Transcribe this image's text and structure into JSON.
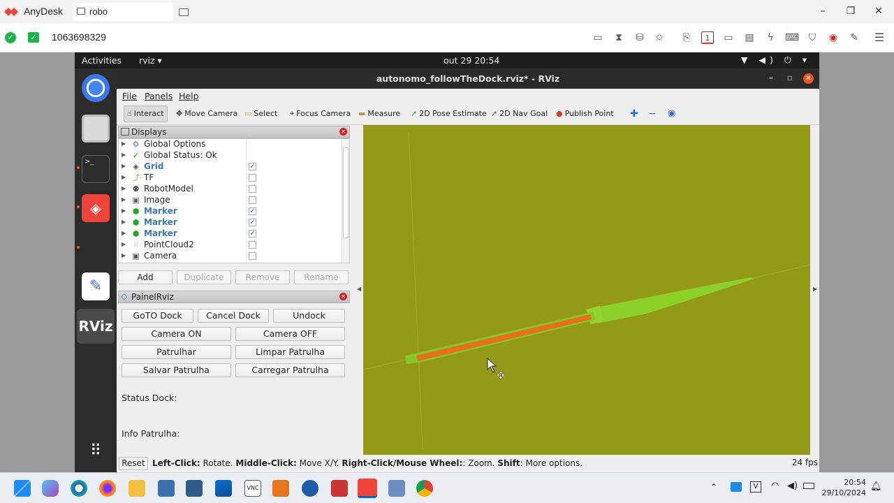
{
  "anydesk": {
    "app_name": "AnyDesk",
    "tab_label": "robo",
    "address_id": "1063698329",
    "window_controls": [
      "–",
      "❐",
      "✕"
    ],
    "toolbar_icons": [
      "chat-icon",
      "hourglass-icon",
      "storage-icon",
      "star-icon",
      "file-icon",
      "monitor-1-icon",
      "display-icon",
      "message-icon",
      "action-icon",
      "keyboard-icon",
      "privacy-icon",
      "record-icon",
      "draw-icon",
      "menu-icon"
    ]
  },
  "gnome": {
    "activities": "Activities",
    "app_menu": "rviz ▾",
    "clock": "out 29  20:54",
    "system_icons": "▼ ◀) ⏻ ▾"
  },
  "rviz": {
    "window_title": "autonomo_followTheDock.rviz* - RViz",
    "menu": {
      "file": "File",
      "panels": "Panels",
      "help": "Help"
    },
    "tools": [
      {
        "label": "Interact",
        "icon": "☝"
      },
      {
        "label": "Move Camera",
        "icon": "✥"
      },
      {
        "label": "Select",
        "icon": "▭"
      },
      {
        "label": "Focus Camera",
        "icon": "⌖"
      },
      {
        "label": "Measure",
        "icon": "▬"
      },
      {
        "label": "2D Pose Estimate",
        "icon": "➚"
      },
      {
        "label": "2D Nav Goal",
        "icon": "➚"
      },
      {
        "label": "Publish Point",
        "icon": "●"
      }
    ],
    "displays": {
      "title": "Displays",
      "items": [
        {
          "label": "Global Options",
          "icon": "⚙",
          "checkbox": null
        },
        {
          "label": "Global Status: Ok",
          "icon": "✓",
          "checkbox": null
        },
        {
          "label": "Grid",
          "icon": "◈",
          "checkbox": true
        },
        {
          "label": "TF",
          "icon": "⤴",
          "checkbox": false
        },
        {
          "label": "RobotModel",
          "icon": "⚉",
          "checkbox": false
        },
        {
          "label": "Image",
          "icon": "▣",
          "checkbox": false
        },
        {
          "label": "Marker",
          "icon": "⬢",
          "checkbox": true
        },
        {
          "label": "Marker",
          "icon": "⬢",
          "checkbox": true
        },
        {
          "label": "Marker",
          "icon": "⬢",
          "checkbox": true
        },
        {
          "label": "PointCloud2",
          "icon": "⁙",
          "checkbox": false
        },
        {
          "label": "Camera",
          "icon": "▣",
          "checkbox": false
        }
      ],
      "buttons": {
        "add": "Add",
        "duplicate": "Duplicate",
        "remove": "Remove",
        "rename": "Rename"
      }
    },
    "painel": {
      "title": "PainelRviz",
      "buttons": {
        "goto_dock": "GoTO Dock",
        "cancel_dock": "Cancel Dock",
        "undock": "Undock",
        "camera_on": "Camera ON",
        "camera_off": "Camera OFF",
        "patrulhar": "Patrulhar",
        "limpar": "Limpar Patrulha",
        "salvar": "Salvar Patrulha",
        "carregar": "Carregar Patrulha"
      },
      "status_dock": "Status Dock:",
      "info_patrulha": "Info Patrulha:"
    },
    "status": {
      "reset": "Reset",
      "hint_left_key": "Left-Click:",
      "hint_left": " Rotate. ",
      "hint_middle_key": "Middle-Click:",
      "hint_middle": " Move X/Y. ",
      "hint_right_key": "Right-Click/Mouse Wheel:",
      "hint_right": ": Zoom. ",
      "hint_shift_key": "Shift",
      "hint_shift": ": More options.",
      "fps": "24 fps"
    },
    "viewport_color": "#949a18"
  },
  "taskbar": {
    "time": "20:54",
    "date": "29/10/2024"
  }
}
